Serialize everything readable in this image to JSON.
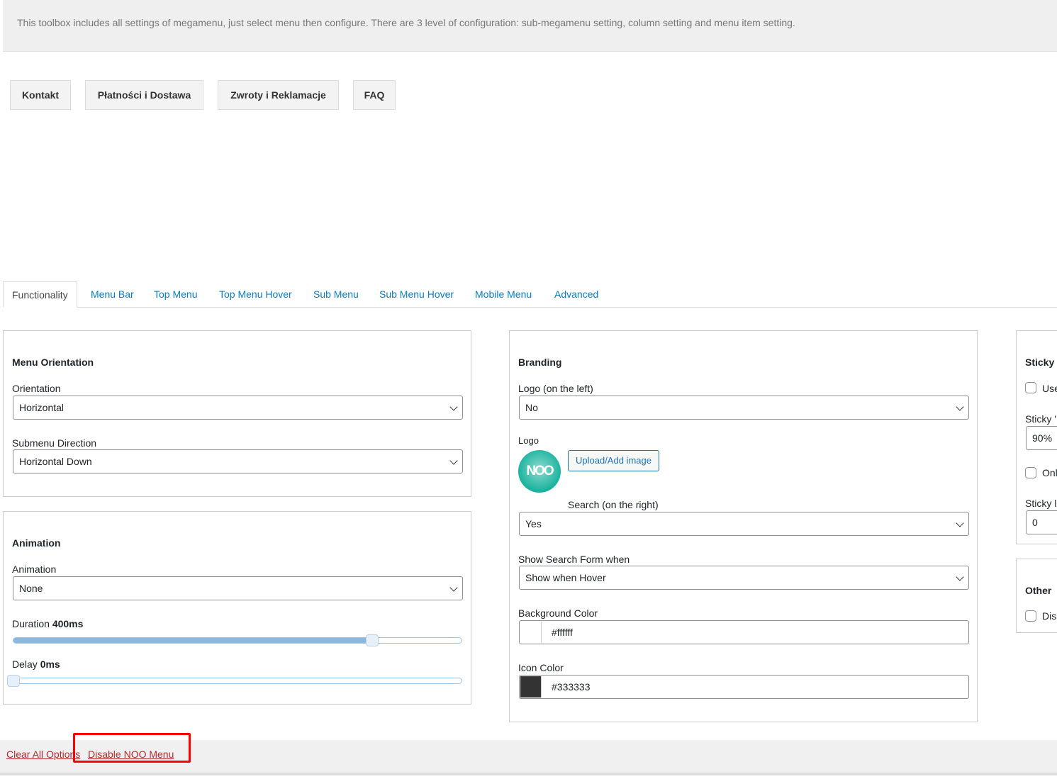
{
  "notice": {
    "text": "This toolbox includes all settings of megamenu, just select menu then configure. There are 3 level of configuration: sub-megamenu setting, column setting and menu item setting."
  },
  "menu_items": [
    "Kontakt",
    "Płatności i Dostawa",
    "Zwroty i Reklamacje",
    "FAQ"
  ],
  "tabs": [
    "Functionality",
    "Menu Bar",
    "Top Menu",
    "Top Menu Hover",
    "Sub Menu",
    "Sub Menu Hover",
    "Mobile Menu",
    "Advanced"
  ],
  "active_tab": "Functionality",
  "orientation_panel": {
    "title": "Menu Orientation",
    "orientation_label": "Orientation",
    "orientation_value": "Horizontal",
    "direction_label": "Submenu Direction",
    "direction_value": "Horizontal Down"
  },
  "animation_panel": {
    "title": "Animation",
    "animation_label": "Animation",
    "animation_value": "None",
    "duration_label": "Duration",
    "duration_value": "400ms",
    "duration_percent": 80,
    "delay_label": "Delay",
    "delay_value": "0ms",
    "delay_percent": 0
  },
  "branding_panel": {
    "title": "Branding",
    "logo_label_select": "Logo (on the left)",
    "logo_value": "No",
    "logo_label": "Logo",
    "logo_text": "NOO",
    "upload_label": "Upload/Add image",
    "search_label": "Search (on the right)",
    "search_value": "Yes",
    "show_search_label": "Show Search Form when",
    "show_search_value": "Show when Hover",
    "bg_color_label": "Background Color",
    "bg_color_value": "#ffffff",
    "icon_color_label": "Icon Color",
    "icon_color_value": "#333333"
  },
  "sticky_panel": {
    "title": "Sticky",
    "use_label": "Use",
    "sticky_w_label": "Sticky '",
    "sticky_w_value": "90%",
    "only_label": "Onl",
    "sticky_l_label": "Sticky l",
    "sticky_l_value": "0"
  },
  "other_panel": {
    "title": "Other",
    "dis_label": "Dis"
  },
  "footer": {
    "clear_label": "Clear All Options",
    "disable_label": "Disable NOO Menu"
  },
  "colors": {
    "link": "#0a7cc2",
    "danger": "#b32d2e",
    "highlight": "#ff0000"
  }
}
